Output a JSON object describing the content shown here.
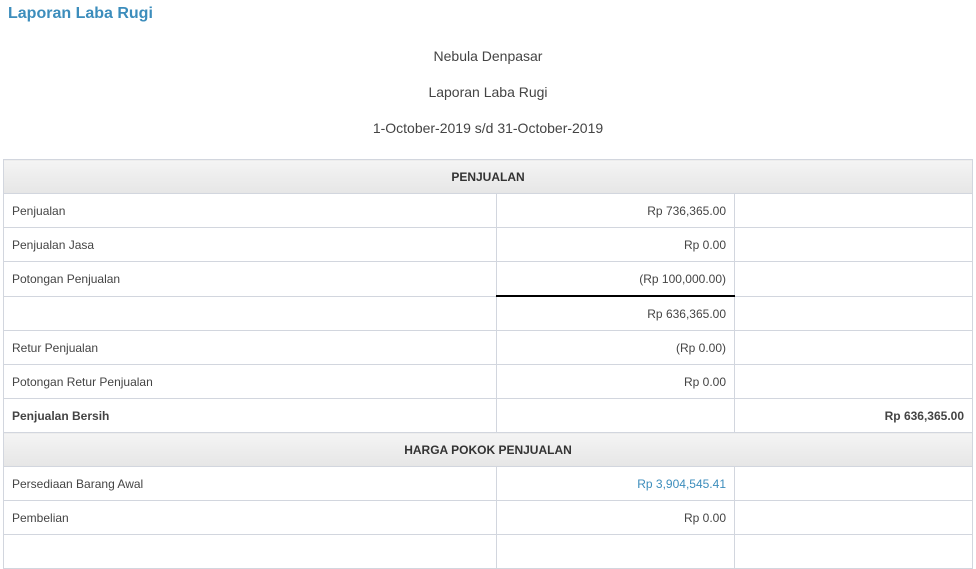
{
  "page": {
    "title": "Laporan Laba Rugi"
  },
  "report": {
    "company": "Nebula Denpasar",
    "title": "Laporan Laba Rugi",
    "period": "1-October-2019 s/d 31-October-2019"
  },
  "sections": {
    "penjualan": "PENJUALAN",
    "hpp": "HARGA POKOK PENJUALAN"
  },
  "rows": [
    {
      "label": "Penjualan",
      "amount": "Rp 736,365.00",
      "total": ""
    },
    {
      "label": "Penjualan Jasa",
      "amount": "Rp 0.00",
      "total": ""
    },
    {
      "label": "Potongan Penjualan",
      "amount": "(Rp 100,000.00)",
      "total": ""
    },
    {
      "label": "",
      "amount": "Rp 636,365.00",
      "total": ""
    },
    {
      "label": "Retur Penjualan",
      "amount": "(Rp 0.00)",
      "total": ""
    },
    {
      "label": "Potongan Retur Penjualan",
      "amount": "Rp 0.00",
      "total": ""
    },
    {
      "label": "Penjualan Bersih",
      "amount": "",
      "total": "Rp 636,365.00"
    },
    {
      "label": "Persediaan Barang Awal",
      "amount": "Rp 3,904,545.41",
      "total": ""
    },
    {
      "label": "Pembelian",
      "amount": "Rp 0.00",
      "total": ""
    },
    {
      "label": "",
      "amount": "",
      "total": ""
    }
  ]
}
